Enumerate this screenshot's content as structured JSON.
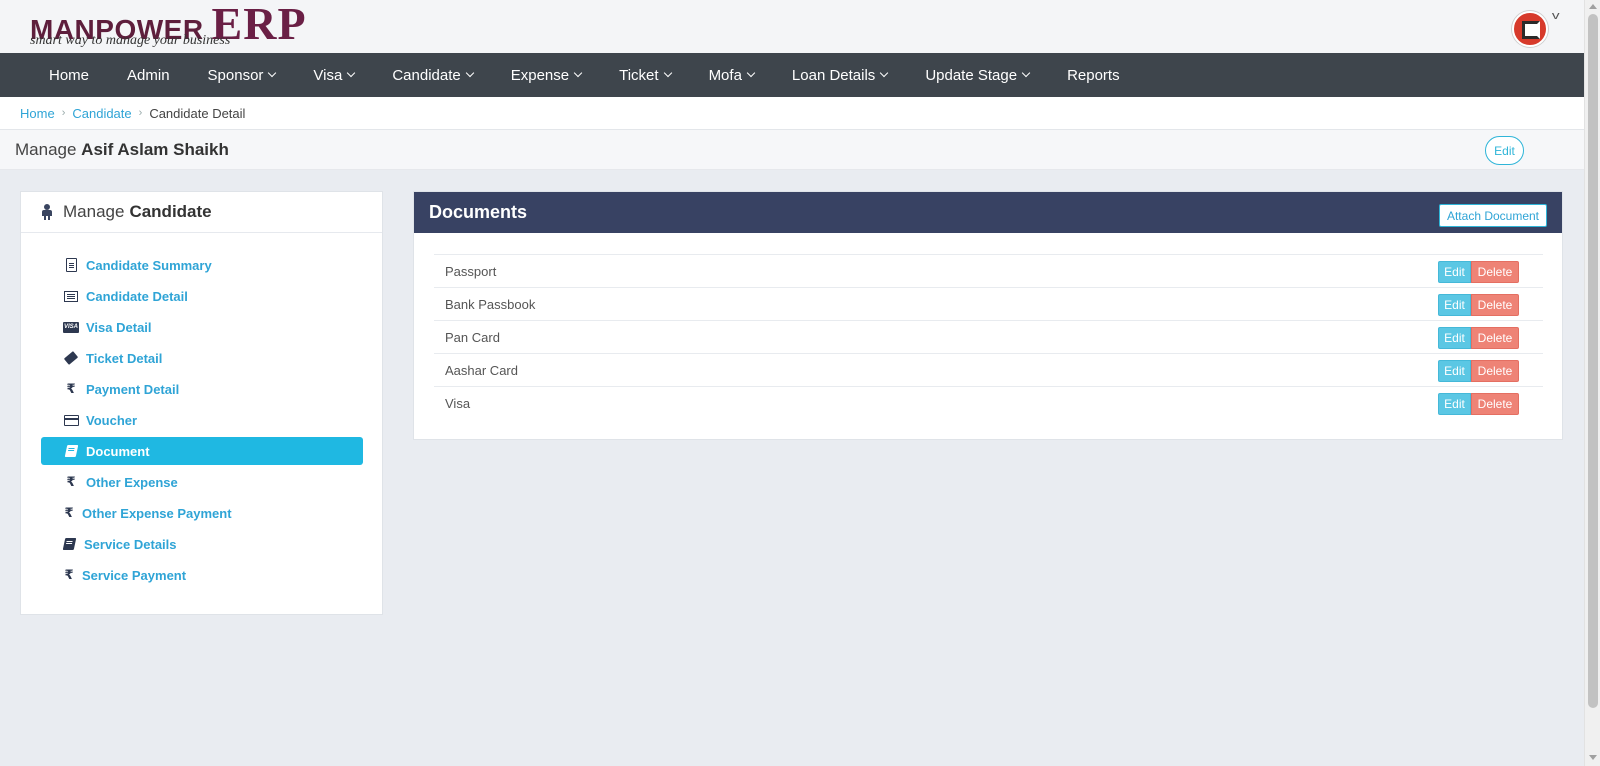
{
  "header": {
    "logo_manpower": "MANPOWER",
    "logo_erp": "ERP",
    "logo_tagline": "smart way to manage your business"
  },
  "nav": {
    "items": [
      {
        "label": "Home",
        "dropdown": false
      },
      {
        "label": "Admin",
        "dropdown": false
      },
      {
        "label": "Sponsor",
        "dropdown": true
      },
      {
        "label": "Visa",
        "dropdown": true
      },
      {
        "label": "Candidate",
        "dropdown": true
      },
      {
        "label": "Expense",
        "dropdown": true
      },
      {
        "label": "Ticket",
        "dropdown": true
      },
      {
        "label": "Mofa",
        "dropdown": true
      },
      {
        "label": "Loan Details",
        "dropdown": true
      },
      {
        "label": "Update Stage",
        "dropdown": true
      },
      {
        "label": "Reports",
        "dropdown": false
      }
    ]
  },
  "breadcrumb": {
    "home": "Home",
    "candidate": "Candidate",
    "current": "Candidate Detail"
  },
  "page": {
    "title_prefix": "Manage",
    "title_name": "Asif Aslam Shaikh",
    "edit_label": "Edit"
  },
  "sidebar": {
    "heading_prefix": "Manage",
    "heading_bold": "Candidate",
    "items": [
      {
        "label": "Candidate Summary",
        "icon": "file-text-icon"
      },
      {
        "label": "Candidate Detail",
        "icon": "list-alt-icon"
      },
      {
        "label": "Visa Detail",
        "icon": "visa-icon",
        "icon_text": "VISA"
      },
      {
        "label": "Ticket Detail",
        "icon": "ticket-icon"
      },
      {
        "label": "Payment Detail",
        "icon": "rupee-icon",
        "icon_text": "₹"
      },
      {
        "label": "Voucher",
        "icon": "credit-card-icon"
      },
      {
        "label": "Document",
        "icon": "book-icon",
        "active": true
      },
      {
        "label": "Other Expense",
        "icon": "rupee-icon",
        "icon_text": "₹"
      },
      {
        "label": "Other Expense Payment",
        "icon": "rupee-icon",
        "icon_text": "₹"
      },
      {
        "label": "Service Details",
        "icon": "book-icon"
      },
      {
        "label": "Service Payment",
        "icon": "rupee-icon",
        "icon_text": "₹"
      }
    ]
  },
  "documents": {
    "title": "Documents",
    "attach_label": "Attach Document",
    "edit_label": "Edit",
    "delete_label": "Delete",
    "rows": [
      {
        "name": "Passport"
      },
      {
        "name": "Bank Passbook"
      },
      {
        "name": "Pan Card"
      },
      {
        "name": "Aashar Card"
      },
      {
        "name": "Visa"
      }
    ]
  },
  "colors": {
    "navbar": "#3e454c",
    "panel_header": "#384263",
    "accent": "#1fb8e2",
    "link": "#2fa4d6",
    "edit_button": "#5bc7e4",
    "delete_button": "#ee8376",
    "brand": "#6a1f45"
  }
}
